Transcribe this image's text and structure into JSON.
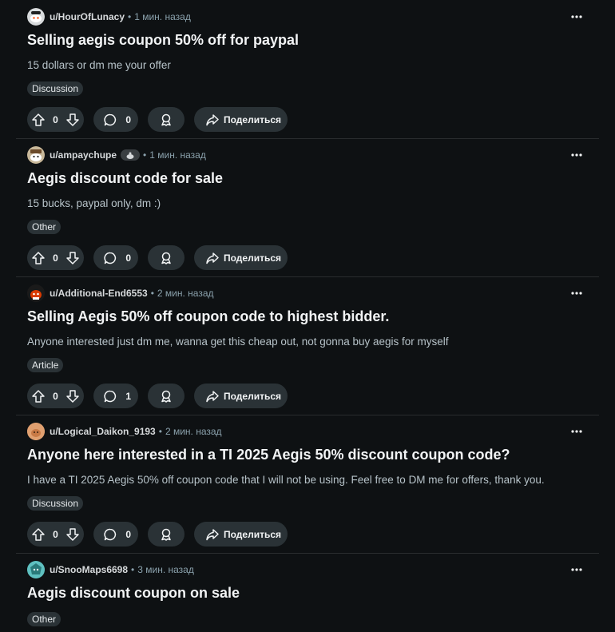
{
  "posts": [
    {
      "author": "u/HourOfLunacy",
      "time": "1 мин. назад",
      "title": "Selling aegis coupon 50% off for paypal",
      "body": "15 dollars or dm me your offer",
      "flair": "Discussion",
      "votes": "0",
      "comments": "0",
      "share": "Поделиться",
      "avatar_color": "#3a3a3a",
      "has_badge": false
    },
    {
      "author": "u/ampaychupe",
      "time": "1 мин. назад",
      "title": "Aegis discount code for sale",
      "body": "15 bucks, paypal only, dm :)",
      "flair": "Other",
      "votes": "0",
      "comments": "0",
      "share": "Поделиться",
      "avatar_color": "#5a4a3a",
      "has_badge": true
    },
    {
      "author": "u/Additional-End6553",
      "time": "2 мин. назад",
      "title": "Selling Aegis 50% off coupon code to highest bidder.",
      "body": "Anyone interested just dm me, wanna get this cheap out, not gonna buy aegis for myself",
      "flair": "Article",
      "votes": "0",
      "comments": "1",
      "share": "Поделиться",
      "avatar_color": "#d93a00",
      "has_badge": false
    },
    {
      "author": "u/Logical_Daikon_9193",
      "time": "2 мин. назад",
      "title": "Anyone here interested in a TI 2025 Aegis 50% discount coupon code?",
      "body": "I have a TI 2025 Aegis 50% off coupon code that I will not be using. Feel free to DM me for offers, thank you.",
      "flair": "Discussion",
      "votes": "0",
      "comments": "0",
      "share": "Поделиться",
      "avatar_color": "#e0a070",
      "has_badge": false
    },
    {
      "author": "u/SnooMaps6698",
      "time": "3 мин. назад",
      "title": "Aegis discount coupon on sale",
      "body": "",
      "flair": "Other",
      "votes": "",
      "comments": "",
      "share": "",
      "avatar_color": "#3aa0a0",
      "has_badge": false
    }
  ],
  "separator": "•",
  "badge_icon": "snoo-badge-icon",
  "colors": {
    "background": "#0e1113",
    "pill": "#2a3236",
    "divider": "#2a2d2f",
    "meta": "#8ba2ad"
  }
}
